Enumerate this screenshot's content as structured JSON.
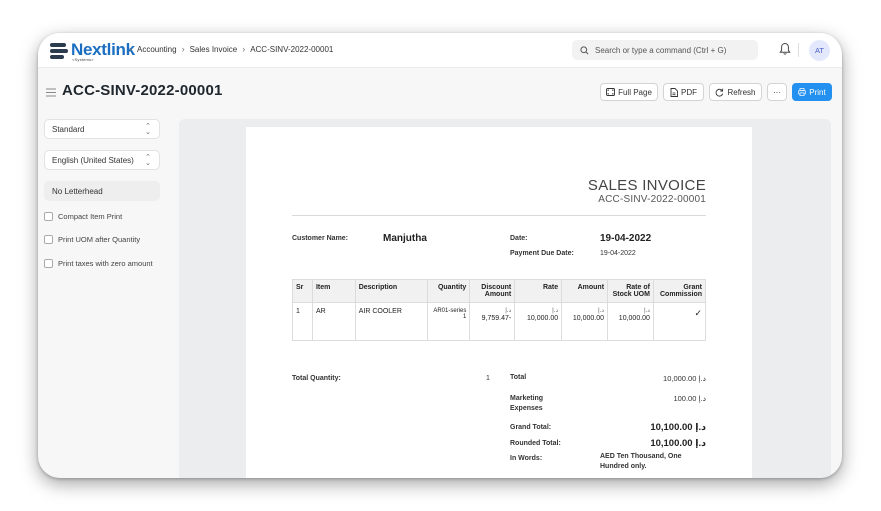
{
  "navbar": {
    "logo_text": "Nextlink",
    "logo_sub": "<Systems>",
    "breadcrumbs": [
      "Accounting",
      "Sales Invoice",
      "ACC-SINV-2022-00001"
    ],
    "search_placeholder": "Search or type a command (Ctrl + G)",
    "avatar_initials": "AT"
  },
  "page": {
    "title": "ACC-SINV-2022-00001",
    "actions": {
      "full_page": "Full Page",
      "pdf": "PDF",
      "refresh": "Refresh",
      "more": "···",
      "print": "Print"
    }
  },
  "sidebar": {
    "print_format": "Standard",
    "language": "English (United States)",
    "letterhead": "No Letterhead",
    "options": [
      "Compact Item Print",
      "Print UOM after Quantity",
      "Print taxes with zero amount"
    ]
  },
  "invoice": {
    "heading": "SALES INVOICE",
    "number": "ACC-SINV-2022-00001",
    "customer_label": "Customer Name:",
    "customer": "Manjutha",
    "date_label": "Date:",
    "date": "19-04-2022",
    "due_label": "Payment Due Date:",
    "due_date": "19-04-2022",
    "currency_symbol": "د.إ",
    "columns": [
      "Sr",
      "Item",
      "Description",
      "Quantity",
      "Discount Amount",
      "Rate",
      "Amount",
      "Rate of Stock UOM",
      "Grant Commission"
    ],
    "rows": [
      {
        "sr": "1",
        "item": "AR",
        "description": "AIR COOLER",
        "quantity": "AR01-series 1",
        "discount": "9,759.47-",
        "rate": "10,000.00",
        "amount": "10,000.00",
        "rate_stock_uom": "10,000.00",
        "grant_commission": "✓"
      }
    ],
    "total_qty_label": "Total Quantity:",
    "total_qty": "1",
    "totals": {
      "total_label": "Total",
      "total": "10,000.00 د.إ",
      "marketing_label": "Marketing Expenses",
      "marketing": "100.00 د.إ",
      "grand_label": "Grand Total:",
      "grand": "10,100.00 د.إ",
      "rounded_label": "Rounded Total:",
      "rounded": "10,100.00 د.إ",
      "words_label": "In Words:",
      "words": "AED Ten Thousand, One Hundred only."
    }
  }
}
